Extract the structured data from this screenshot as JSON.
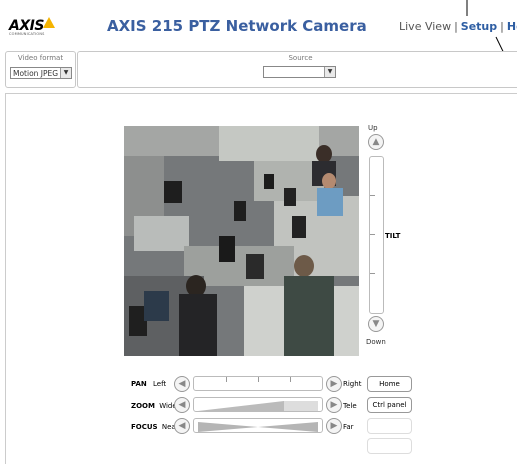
{
  "header": {
    "logo_text": "AXIS",
    "logo_subtext": "COMMUNICATIONS",
    "title": "AXIS 215 PTZ Network Camera",
    "nav": {
      "live_view": "Live View",
      "separator": "|",
      "setup": "Setup",
      "help": "Help"
    }
  },
  "video_format": {
    "label": "Video format",
    "selected": "Motion JPEG"
  },
  "source": {
    "label": "Source",
    "selected": ""
  },
  "tilt": {
    "up_label": "Up",
    "down_label": "Down",
    "name": "TILT"
  },
  "pan": {
    "name": "PAN",
    "left_label": "Left",
    "right_label": "Right",
    "button": "Home"
  },
  "zoom": {
    "name": "ZOOM",
    "wide_label": "Wide",
    "tele_label": "Tele",
    "button": "Ctrl panel"
  },
  "focus": {
    "name": "FOCUS",
    "near_label": "Near",
    "far_label": "Far"
  },
  "icons": {
    "arrow_up": "arrow-up-icon",
    "arrow_down": "arrow-down-icon",
    "arrow_left": "arrow-left-icon",
    "arrow_right": "arrow-right-icon",
    "dropdown": "chevron-down-icon"
  },
  "colors": {
    "title_blue": "#3a5fa0",
    "link_blue": "#2e5ea3",
    "logo_yellow": "#f5b400"
  }
}
